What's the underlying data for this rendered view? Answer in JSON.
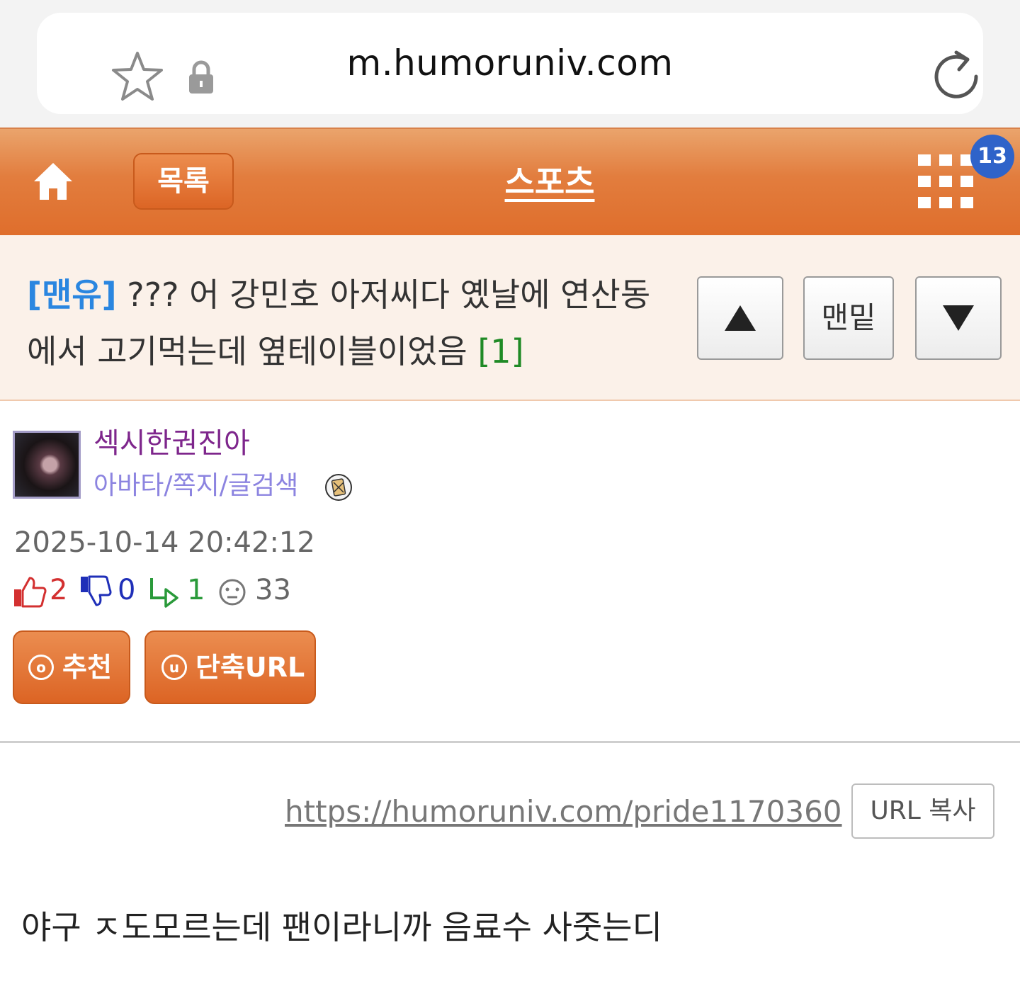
{
  "browser": {
    "url": "m.humoruniv.com"
  },
  "header": {
    "list_label": "목록",
    "board_title": "스포츠",
    "notification_count": "13"
  },
  "post": {
    "category": "[맨유]",
    "title": " ??? 어 강민호 아저씨다 옜날에 연산동에서 고기먹는데 옆테이블이었음 ",
    "comment_count": "[1]",
    "nav": {
      "bottom_label": "맨밑"
    },
    "author": {
      "name": "섹시한권진아",
      "links": "아바타/쪽지/글검색"
    },
    "date": "2025-10-14 20:42:12",
    "stats": {
      "likes": "2",
      "dislikes": "0",
      "replies": "1",
      "views": "33"
    },
    "buttons": {
      "recommend_label": "추천",
      "recommend_icon_char": "o",
      "short_url_label": "단축URL",
      "short_url_icon_char": "u"
    },
    "short_url": "https://humoruniv.com/pride1170360",
    "copy_label": "URL 복사",
    "body": "야구 ㅈ도모르는데 팬이라니까 음료수 사줏는디"
  },
  "colors": {
    "accent_orange": "#df6e2c",
    "category_blue": "#2a86e0",
    "comment_green": "#1f8a25",
    "author_purple": "#7e268c",
    "link_lavender": "#8c84e0",
    "like_red": "#d33030",
    "dislike_blue": "#1f2fb8",
    "badge_blue": "#2f63c9"
  }
}
